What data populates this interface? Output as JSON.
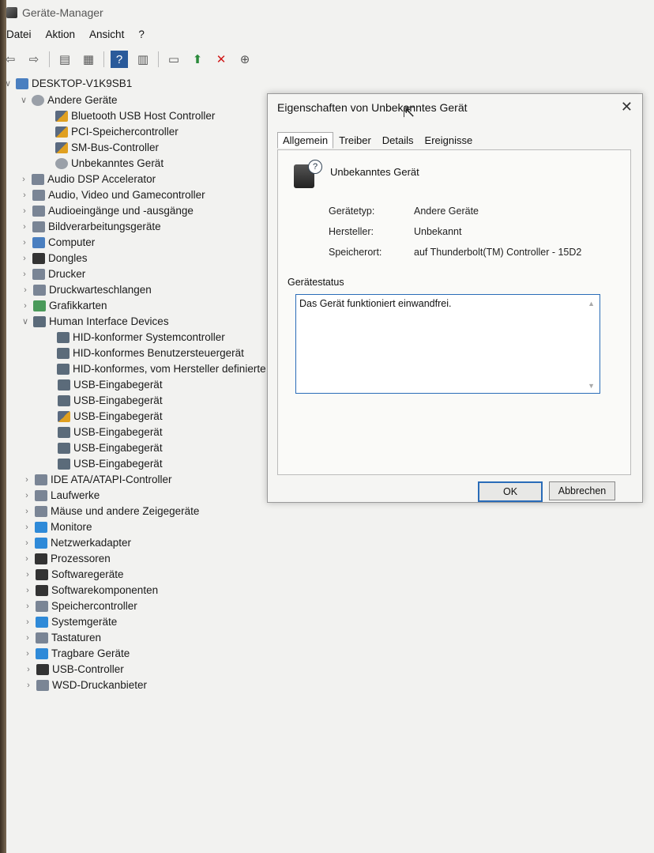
{
  "window": {
    "title": "Geräte-Manager"
  },
  "menu": [
    "Datei",
    "Aktion",
    "Ansicht",
    "?"
  ],
  "toolbar": [
    {
      "name": "back-icon",
      "glyph": "⇦"
    },
    {
      "name": "forward-icon",
      "glyph": "⇨"
    },
    {
      "name": "show-hide-icon",
      "glyph": "▤"
    },
    {
      "name": "properties-icon",
      "glyph": "▦"
    },
    {
      "name": "help-icon",
      "glyph": "?"
    },
    {
      "name": "view-icon",
      "glyph": "▥"
    },
    {
      "name": "monitor-icon",
      "glyph": "▭"
    },
    {
      "name": "update-driver-icon",
      "glyph": "⬆"
    },
    {
      "name": "uninstall-icon",
      "glyph": "✕"
    },
    {
      "name": "download-icon",
      "glyph": "⊕"
    }
  ],
  "tree": {
    "root": "DESKTOP-V1K9SB1",
    "items": [
      {
        "label": "Andere Geräte",
        "level": 1,
        "chev": "∨",
        "icon": "unk"
      },
      {
        "label": "Bluetooth USB Host Controller",
        "level": 2,
        "chev": "",
        "icon": "warn"
      },
      {
        "label": "PCI-Speichercontroller",
        "level": 2,
        "chev": "",
        "icon": "warn"
      },
      {
        "label": "SM-Bus-Controller",
        "level": 2,
        "chev": "",
        "icon": "warn"
      },
      {
        "label": "Unbekanntes Gerät",
        "level": 2,
        "chev": "",
        "icon": "unk"
      },
      {
        "label": "Audio DSP Accelerator",
        "level": 1,
        "chev": "›",
        "icon": "gen"
      },
      {
        "label": "Audio, Video und Gamecontroller",
        "level": 1,
        "chev": "›",
        "icon": "gen"
      },
      {
        "label": "Audioeingänge und -ausgänge",
        "level": 1,
        "chev": "›",
        "icon": "gen"
      },
      {
        "label": "Bildverarbeitungsgeräte",
        "level": 1,
        "chev": "›",
        "icon": "gen"
      },
      {
        "label": "Computer",
        "level": 1,
        "chev": "›",
        "icon": "pc"
      },
      {
        "label": "Dongles",
        "level": 1,
        "chev": "›",
        "icon": "dark"
      },
      {
        "label": "Drucker",
        "level": 1,
        "chev": "›",
        "icon": "gen"
      },
      {
        "label": "Druckwarteschlangen",
        "level": 1,
        "chev": "›",
        "icon": "gen"
      },
      {
        "label": "Grafikkarten",
        "level": 1,
        "chev": "›",
        "icon": "green"
      },
      {
        "label": "Human Interface Devices",
        "level": 1,
        "chev": "∨",
        "icon": "hid"
      },
      {
        "label": "HID-konformer Systemcontroller",
        "level": 2,
        "chev": "",
        "icon": "hid"
      },
      {
        "label": "HID-konformes Benutzersteuergerät",
        "level": 2,
        "chev": "",
        "icon": "hid"
      },
      {
        "label": "HID-konformes, vom Hersteller definierte",
        "level": 2,
        "chev": "",
        "icon": "hid"
      },
      {
        "label": "USB-Eingabegerät",
        "level": 2,
        "chev": "",
        "icon": "hid"
      },
      {
        "label": "USB-Eingabegerät",
        "level": 2,
        "chev": "",
        "icon": "hid"
      },
      {
        "label": "USB-Eingabegerät",
        "level": 2,
        "chev": "",
        "icon": "warn"
      },
      {
        "label": "USB-Eingabegerät",
        "level": 2,
        "chev": "",
        "icon": "hid"
      },
      {
        "label": "USB-Eingabegerät",
        "level": 2,
        "chev": "",
        "icon": "hid"
      },
      {
        "label": "USB-Eingabegerät",
        "level": 2,
        "chev": "",
        "icon": "hid"
      },
      {
        "label": "IDE ATA/ATAPI-Controller",
        "level": 1,
        "chev": "›",
        "icon": "gen"
      },
      {
        "label": "Laufwerke",
        "level": 1,
        "chev": "›",
        "icon": "gen"
      },
      {
        "label": "Mäuse und andere Zeigegeräte",
        "level": 1,
        "chev": "›",
        "icon": "gen"
      },
      {
        "label": "Monitore",
        "level": 1,
        "chev": "›",
        "icon": "blue"
      },
      {
        "label": "Netzwerkadapter",
        "level": 1,
        "chev": "›",
        "icon": "blue"
      },
      {
        "label": "Prozessoren",
        "level": 1,
        "chev": "›",
        "icon": "dark"
      },
      {
        "label": "Softwaregeräte",
        "level": 1,
        "chev": "›",
        "icon": "dark"
      },
      {
        "label": "Softwarekomponenten",
        "level": 1,
        "chev": "›",
        "icon": "dark"
      },
      {
        "label": "Speichercontroller",
        "level": 1,
        "chev": "›",
        "icon": "gen"
      },
      {
        "label": "Systemgeräte",
        "level": 1,
        "chev": "›",
        "icon": "blue"
      },
      {
        "label": "Tastaturen",
        "level": 1,
        "chev": "›",
        "icon": "gen"
      },
      {
        "label": "Tragbare Geräte",
        "level": 1,
        "chev": "›",
        "icon": "blue"
      },
      {
        "label": "USB-Controller",
        "level": 1,
        "chev": "›",
        "icon": "dark"
      },
      {
        "label": "WSD-Druckanbieter",
        "level": 1,
        "chev": "›",
        "icon": "gen"
      }
    ]
  },
  "dialog": {
    "title": "Eigenschaften von Unbekanntes Gerät",
    "tabs": [
      "Allgemein",
      "Treiber",
      "Details",
      "Ereignisse"
    ],
    "device_name": "Unbekanntes Gerät",
    "properties": [
      {
        "label": "Gerätetyp:",
        "value": "Andere Geräte"
      },
      {
        "label": "Hersteller:",
        "value": "Unbekannt"
      },
      {
        "label": "Speicherort:",
        "value": "auf Thunderbolt(TM) Controller - 15D2"
      }
    ],
    "status_label": "Gerätestatus",
    "status_text": "Das Gerät funktioniert einwandfrei.",
    "ok_label": "OK",
    "cancel_label": "Abbrechen"
  }
}
